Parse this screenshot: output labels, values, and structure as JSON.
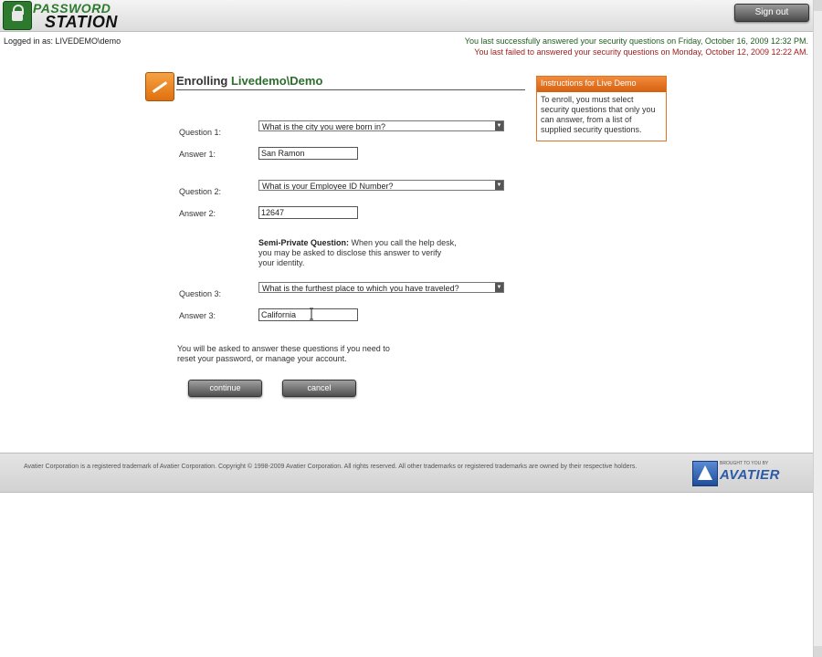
{
  "header": {
    "logo_line1": "PASSWORD",
    "logo_line2": "STATION",
    "signout_label": "Sign out"
  },
  "status": {
    "logged_in": "Logged in as: LIVEDEMO\\demo",
    "last_success": "You last successfully answered your security questions on Friday, October 16, 2009 12:32 PM.",
    "last_failed": "You last failed to answered your security questions on Monday, October 12, 2009 12:22 AM."
  },
  "title": {
    "prefix": "Enrolling",
    "name": "Livedemo\\Demo"
  },
  "instructions": {
    "heading": "Instructions for Live Demo",
    "body": "To enroll, you must select security questions that only you can answer, from a list of supplied security questions."
  },
  "form": {
    "q1_label": "Question 1:",
    "q1_value": "What is the city you were born in?",
    "a1_label": "Answer 1:",
    "a1_value": "San Ramon",
    "q2_label": "Question 2:",
    "q2_value": "What is your Employee ID Number?",
    "a2_label": "Answer 2:",
    "a2_value": "12647",
    "semi_heading": "Semi-Private Question:",
    "semi_text1": " When you call the help desk,",
    "semi_text2": "you may be asked to disclose this answer to verify",
    "semi_text3": "your identity.",
    "q3_label": "Question 3:",
    "q3_value": "What is the furthest place to which you have traveled?",
    "a3_label": "Answer 3:",
    "a3_value": "California",
    "note_line1": "You will be asked to answer these questions if you need to",
    "note_line2": "reset your password, or manage your account.",
    "continue_label": "continue",
    "cancel_label": "cancel"
  },
  "footer": {
    "copyright": "Avatier Corporation is a registered trademark of Avatier Corporation. Copyright © 1998-2009 Avatier Corporation. All rights reserved. All other trademarks or registered trademarks are owned by their respective holders.",
    "brand_small": "BROUGHT TO YOU BY",
    "brand_name": "AVATIER"
  }
}
